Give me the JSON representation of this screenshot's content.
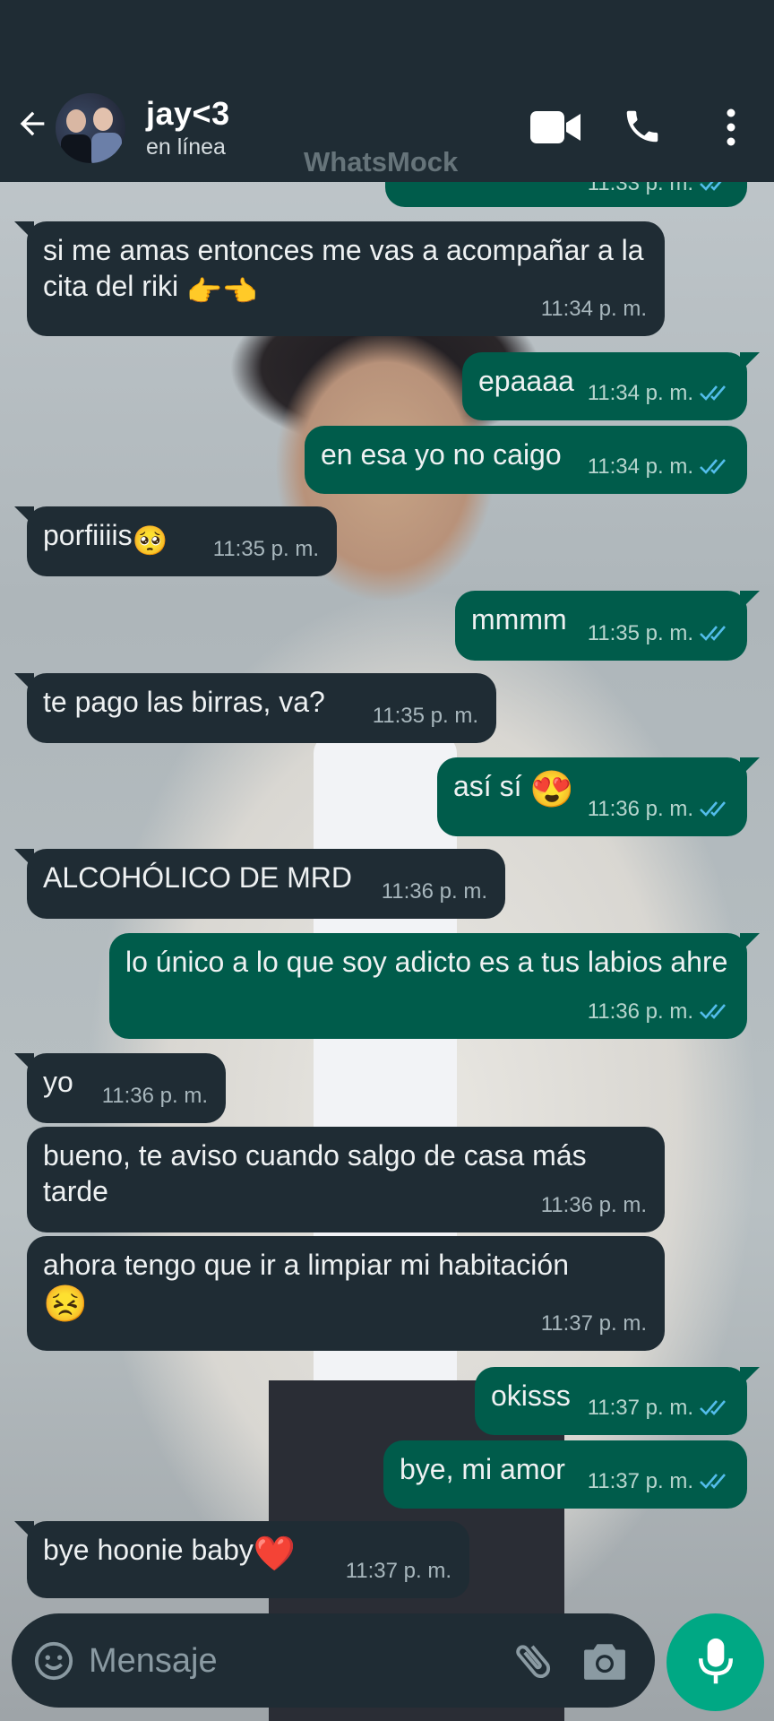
{
  "header": {
    "contact_name": "jay<3",
    "status": "en línea",
    "watermark": "WhatsMock"
  },
  "messages": [
    {
      "dir": "out",
      "text": "",
      "time": "11:33 p. m.",
      "ticks": true,
      "partial": true
    },
    {
      "dir": "in",
      "text": "si me amas entonces me vas a acompañar a la cita del riki",
      "emoji": "👉👈",
      "time": "11:34 p. m."
    },
    {
      "dir": "out",
      "text": "epaaaa",
      "time": "11:34 p. m.",
      "ticks": true
    },
    {
      "dir": "out",
      "text": "en esa yo no caigo",
      "time": "11:34 p. m.",
      "ticks": true
    },
    {
      "dir": "in",
      "text": "porfiiiis",
      "emoji": "🥺",
      "time": "11:35 p. m."
    },
    {
      "dir": "out",
      "text": "mmmm",
      "time": "11:35 p. m.",
      "ticks": true
    },
    {
      "dir": "in",
      "text": "te pago las birras, va?",
      "time": "11:35 p. m."
    },
    {
      "dir": "out",
      "text": "así sí",
      "emoji": "😍",
      "time": "11:36 p. m.",
      "ticks": true
    },
    {
      "dir": "in",
      "text": "ALCOHÓLICO DE MRD",
      "time": "11:36 p. m."
    },
    {
      "dir": "out",
      "text": "lo único a lo que soy adicto es a tus labios ahre",
      "time": "11:36 p. m.",
      "ticks": true
    },
    {
      "dir": "in",
      "text": "yo",
      "time": "11:36 p. m."
    },
    {
      "dir": "in",
      "text": "bueno, te aviso cuando salgo de casa más tarde",
      "time": "11:36 p. m."
    },
    {
      "dir": "in",
      "text": "ahora tengo que ir a limpiar mi habitación",
      "emoji": "😣",
      "time": "11:37 p. m."
    },
    {
      "dir": "out",
      "text": "okisss",
      "time": "11:37 p. m.",
      "ticks": true
    },
    {
      "dir": "out",
      "text": "bye, mi amor",
      "time": "11:37 p. m.",
      "ticks": true
    },
    {
      "dir": "in",
      "text": "bye hoonie baby",
      "emoji": "❤️",
      "time": "11:37 p. m."
    }
  ],
  "composer": {
    "placeholder": "Mensaje"
  },
  "icons": {
    "back": "arrow-left-icon",
    "video": "video-camera-icon",
    "call": "phone-icon",
    "menu": "more-vertical-icon",
    "emoji": "smiley-icon",
    "attach": "paperclip-icon",
    "camera": "camera-icon",
    "mic": "microphone-icon",
    "read": "double-check-icon"
  },
  "colors": {
    "header_bg": "#1f2c34",
    "incoming_bubble": "#1f2c34",
    "outgoing_bubble": "#005c4b",
    "read_ticks": "#53bdeb",
    "mic_button": "#00a884"
  }
}
